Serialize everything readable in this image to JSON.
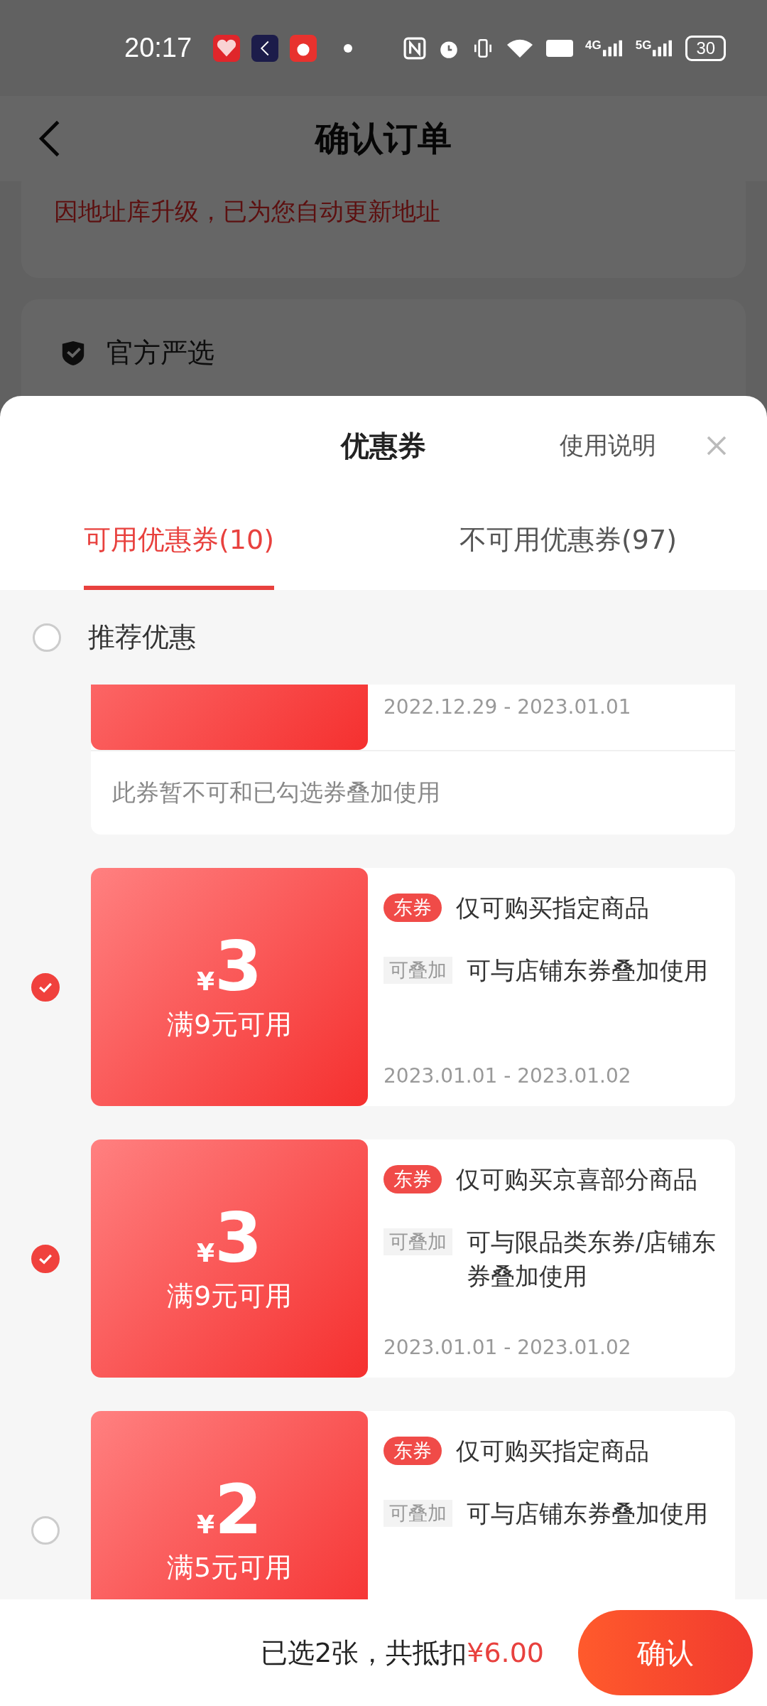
{
  "status_bar": {
    "time": "20:17",
    "signal_labels": [
      "4G",
      "5G"
    ],
    "battery": "30"
  },
  "header": {
    "title": "确认订单"
  },
  "address_notice": "因地址库升级，已为您自动更新地址",
  "store": {
    "name": "官方严选"
  },
  "sheet": {
    "title": "优惠券",
    "help": "使用说明",
    "tabs": [
      {
        "label": "可用优惠券(10)",
        "selected": true
      },
      {
        "label": "不可用优惠券(97)",
        "selected": false
      }
    ],
    "recommend": {
      "label": "推荐优惠",
      "checked": false
    },
    "partial_coupon": {
      "date": "2022.12.29 - 2023.01.01",
      "note": "此券暂不可和已勾选券叠加使用"
    },
    "coupons": [
      {
        "checked": true,
        "currency": "¥",
        "amount": "3",
        "threshold": "满9元可用",
        "tag": "东券",
        "scope": "仅可购买指定商品",
        "stack_tag": "可叠加",
        "stack_text": "可与店铺东券叠加使用",
        "date": "2023.01.01 - 2023.01.02"
      },
      {
        "checked": true,
        "currency": "¥",
        "amount": "3",
        "threshold": "满9元可用",
        "tag": "东券",
        "scope": "仅可购买京喜部分商品",
        "stack_tag": "可叠加",
        "stack_text": "可与限品类东券/店铺东券叠加使用",
        "date": "2023.01.01 - 2023.01.02"
      },
      {
        "checked": false,
        "currency": "¥",
        "amount": "2",
        "threshold": "满5元可用",
        "tag": "东券",
        "scope": "仅可购买指定商品",
        "stack_tag": "可叠加",
        "stack_text": "可与店铺东券叠加使用"
      }
    ]
  },
  "footer": {
    "summary": "已选2张，共抵扣",
    "amount": "¥6.00",
    "confirm": "确认"
  }
}
